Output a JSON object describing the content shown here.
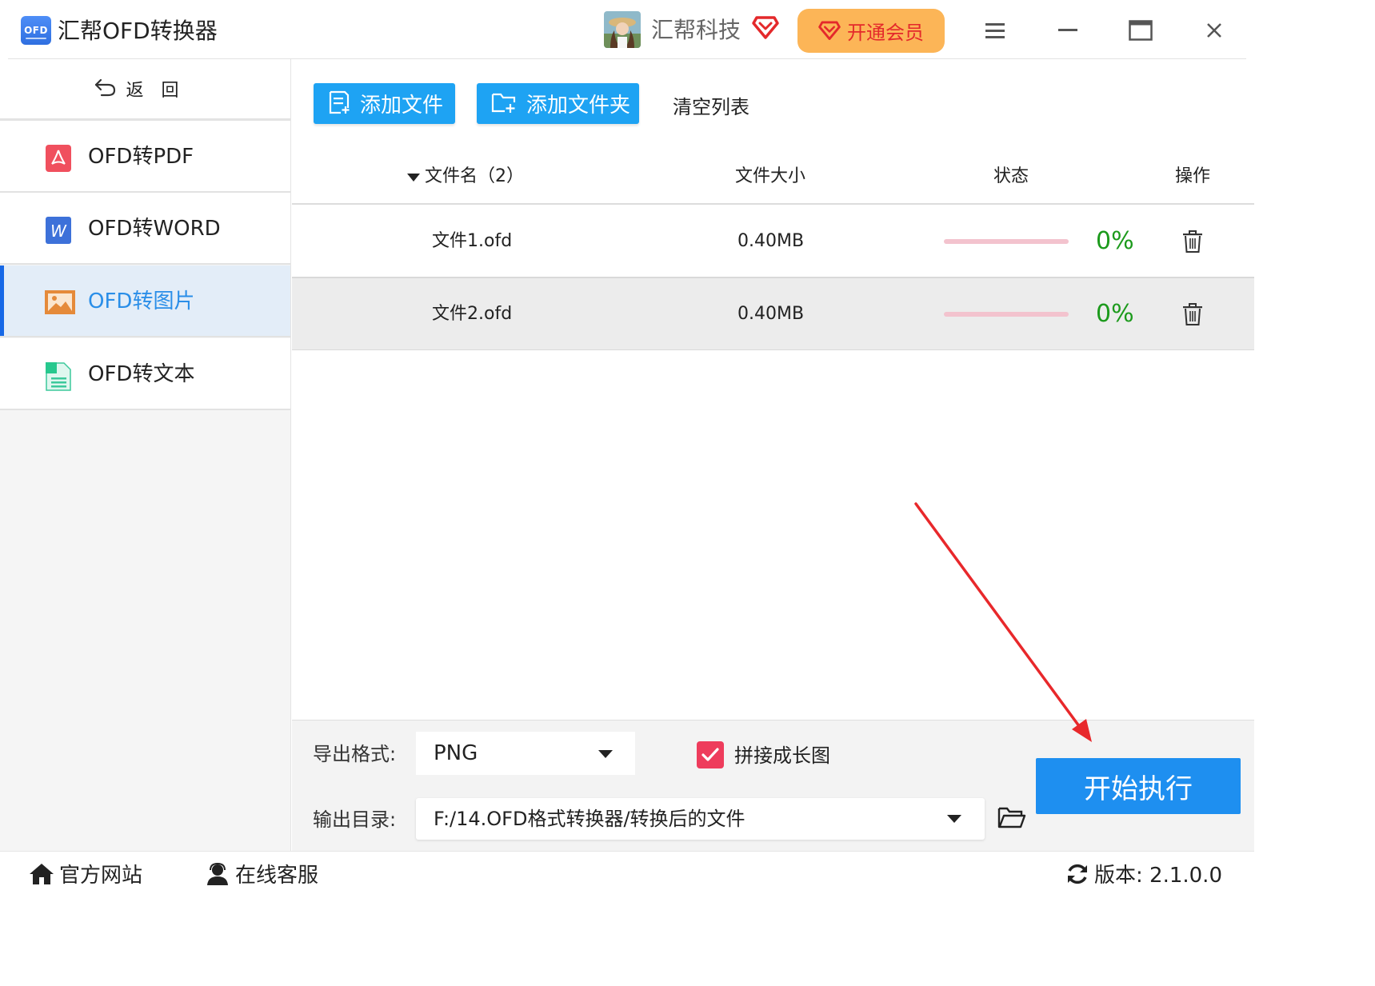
{
  "app": {
    "logo_text": "OFD",
    "title": "汇帮OFD转换器"
  },
  "header": {
    "user_name": "汇帮科技",
    "vip_label": "开通会员",
    "menu_icon": "hamburger-icon",
    "minimize_icon": "minimize-icon",
    "maximize_icon": "maximize-icon",
    "close_icon": "close-icon"
  },
  "sidebar": {
    "back_label": "返回",
    "items": [
      {
        "label": "OFD转PDF",
        "icon": "pdf-icon"
      },
      {
        "label": "OFD转WORD",
        "icon": "word-icon"
      },
      {
        "label": "OFD转图片",
        "icon": "image-icon",
        "active": true
      },
      {
        "label": "OFD转文本",
        "icon": "text-doc-icon"
      }
    ]
  },
  "toolbar": {
    "add_file": "添加文件",
    "add_folder": "添加文件夹",
    "clear_list": "清空列表"
  },
  "table": {
    "headers": {
      "name": "文件名（2）",
      "size": "文件大小",
      "status": "状态",
      "action": "操作"
    },
    "rows": [
      {
        "name": "文件1.ofd",
        "size": "0.40MB",
        "progress": "0%",
        "progress_fraction": 0
      },
      {
        "name": "文件2.ofd",
        "size": "0.40MB",
        "progress": "0%",
        "progress_fraction": 0
      }
    ]
  },
  "bottom": {
    "format_label": "导出格式:",
    "format_value": "PNG",
    "long_image_label": "拼接成长图",
    "long_image_checked": true,
    "dir_label": "输出目录:",
    "dir_value": "F:/14.OFD格式转换器/转换后的文件",
    "start_label": "开始执行"
  },
  "statusbar": {
    "website": "官方网站",
    "support": "在线客服",
    "version": "版本:  2.1.0.0"
  },
  "colors": {
    "primary": "#1ea3f3",
    "start_button": "#1e8ff0",
    "vip_bg": "#fcb557",
    "vip_text": "#e4292b",
    "progress_text": "#1c9a1c",
    "progress_track": "#f3c3ce",
    "checkbox": "#ee3c5c",
    "active_nav_text": "#2a8ee8",
    "annotation_arrow": "#e8282b"
  }
}
